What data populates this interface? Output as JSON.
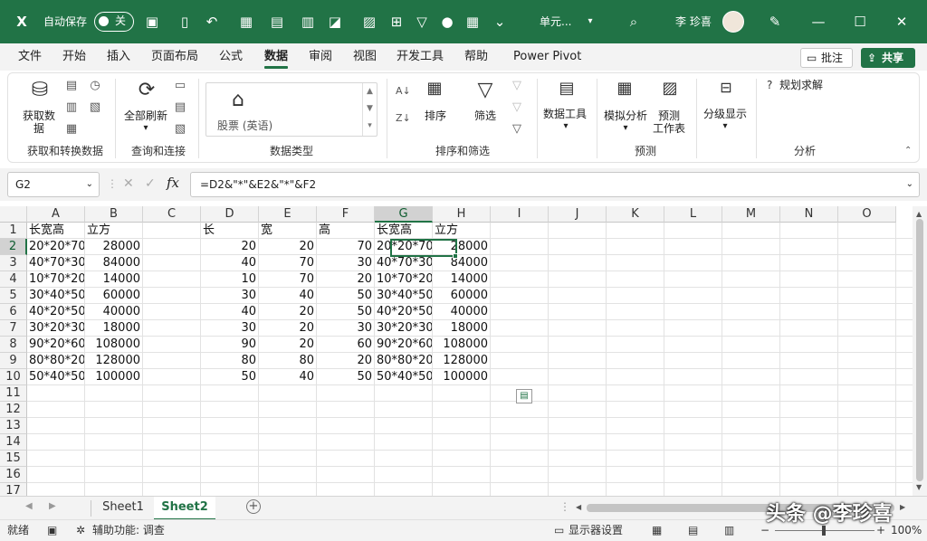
{
  "titlebar": {
    "autosave_label": "自动保存",
    "autosave_state": "关",
    "doc_title": "单元...",
    "user_name": "李 珍喜"
  },
  "menu": {
    "tabs": [
      "文件",
      "开始",
      "插入",
      "页面布局",
      "公式",
      "数据",
      "审阅",
      "视图",
      "开发工具",
      "帮助",
      "Power Pivot"
    ],
    "active_tab": "数据",
    "comment_button": "批注",
    "share_button": "共享"
  },
  "ribbon": {
    "get_data": "获取数\n据",
    "refresh_all": "全部刷新",
    "stocks": "股票 (英语)",
    "sort": "排序",
    "filter": "筛选",
    "data_tools": "数据工具",
    "what_if": "模拟分析",
    "forecast_sheet": "预测\n工作表",
    "outline": "分级显示",
    "solver": "规划求解",
    "groups": {
      "get_transform": "获取和转换数据",
      "queries": "查询和连接",
      "data_types": "数据类型",
      "sort_filter": "排序和筛选",
      "forecast": "预测",
      "analysis": "分析"
    }
  },
  "formula_bar": {
    "name_box": "G2",
    "fx": "fx",
    "formula": "=D2&\"*\"&E2&\"*\"&F2"
  },
  "grid": {
    "columns": [
      "A",
      "B",
      "C",
      "D",
      "E",
      "F",
      "G",
      "H",
      "I",
      "J",
      "K",
      "L",
      "M",
      "N",
      "O"
    ],
    "rows": [
      "1",
      "2",
      "3",
      "4",
      "5",
      "6",
      "7",
      "8",
      "9",
      "10",
      "11",
      "12",
      "13",
      "14",
      "15",
      "16",
      "17"
    ],
    "selected_cell": "G2",
    "headers": {
      "A": "长宽高",
      "B": "立方",
      "D": "长",
      "E": "宽",
      "F": "高",
      "G": "长宽高",
      "H": "立方"
    },
    "data": [
      {
        "A": "20*20*70",
        "B": "28000",
        "D": "20",
        "E": "20",
        "F": "70",
        "G": "20*20*70",
        "H": "28000"
      },
      {
        "A": "40*70*30",
        "B": "84000",
        "D": "40",
        "E": "70",
        "F": "30",
        "G": "40*70*30",
        "H": "84000"
      },
      {
        "A": "10*70*20",
        "B": "14000",
        "D": "10",
        "E": "70",
        "F": "20",
        "G": "10*70*20",
        "H": "14000"
      },
      {
        "A": "30*40*50",
        "B": "60000",
        "D": "30",
        "E": "40",
        "F": "50",
        "G": "30*40*50",
        "H": "60000"
      },
      {
        "A": "40*20*50",
        "B": "40000",
        "D": "40",
        "E": "20",
        "F": "50",
        "G": "40*20*50",
        "H": "40000"
      },
      {
        "A": "30*20*30",
        "B": "18000",
        "D": "30",
        "E": "20",
        "F": "30",
        "G": "30*20*30",
        "H": "18000"
      },
      {
        "A": "90*20*60",
        "B": "108000",
        "D": "90",
        "E": "20",
        "F": "60",
        "G": "90*20*60",
        "H": "108000"
      },
      {
        "A": "80*80*20",
        "B": "128000",
        "D": "80",
        "E": "80",
        "F": "20",
        "G": "80*80*20",
        "H": "128000"
      },
      {
        "A": "50*40*50",
        "B": "100000",
        "D": "50",
        "E": "40",
        "F": "50",
        "G": "50*40*50",
        "H": "100000"
      }
    ]
  },
  "sheets": {
    "tabs": [
      "Sheet1",
      "Sheet2"
    ],
    "active": "Sheet2"
  },
  "status": {
    "ready": "就绪",
    "accessibility": "辅助功能: 调查",
    "display_settings": "显示器设置",
    "zoom": "100%"
  },
  "watermark": "头条 @李珍喜",
  "colors": {
    "brand": "#217346",
    "selection": "#217346"
  }
}
